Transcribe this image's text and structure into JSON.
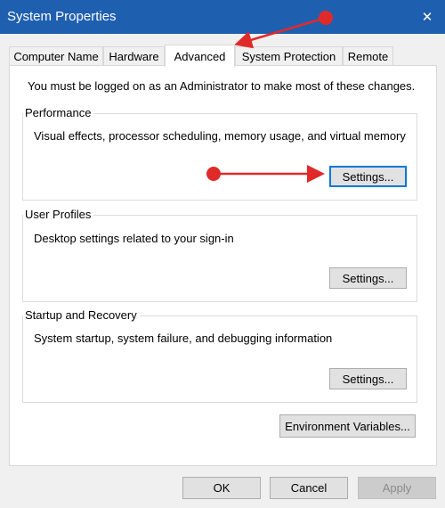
{
  "window": {
    "title": "System Properties",
    "close_glyph": "✕"
  },
  "tabs": [
    {
      "label": "Computer Name",
      "active": false
    },
    {
      "label": "Hardware",
      "active": false
    },
    {
      "label": "Advanced",
      "active": true
    },
    {
      "label": "System Protection",
      "active": false
    },
    {
      "label": "Remote",
      "active": false
    }
  ],
  "admin_note": "You must be logged on as an Administrator to make most of these changes.",
  "groups": {
    "performance": {
      "title": "Performance",
      "description": "Visual effects, processor scheduling, memory usage, and virtual memory",
      "button": "Settings..."
    },
    "user_profiles": {
      "title": "User Profiles",
      "description": "Desktop settings related to your sign-in",
      "button": "Settings..."
    },
    "startup_recovery": {
      "title": "Startup and Recovery",
      "description": "System startup, system failure, and debugging information",
      "button": "Settings..."
    }
  },
  "environment_button": "Environment Variables...",
  "footer": {
    "ok": "OK",
    "cancel": "Cancel",
    "apply": "Apply"
  },
  "colors": {
    "titlebar": "#1f5fb0",
    "annotation": "#e02a2a",
    "focus_border": "#0078d7"
  }
}
